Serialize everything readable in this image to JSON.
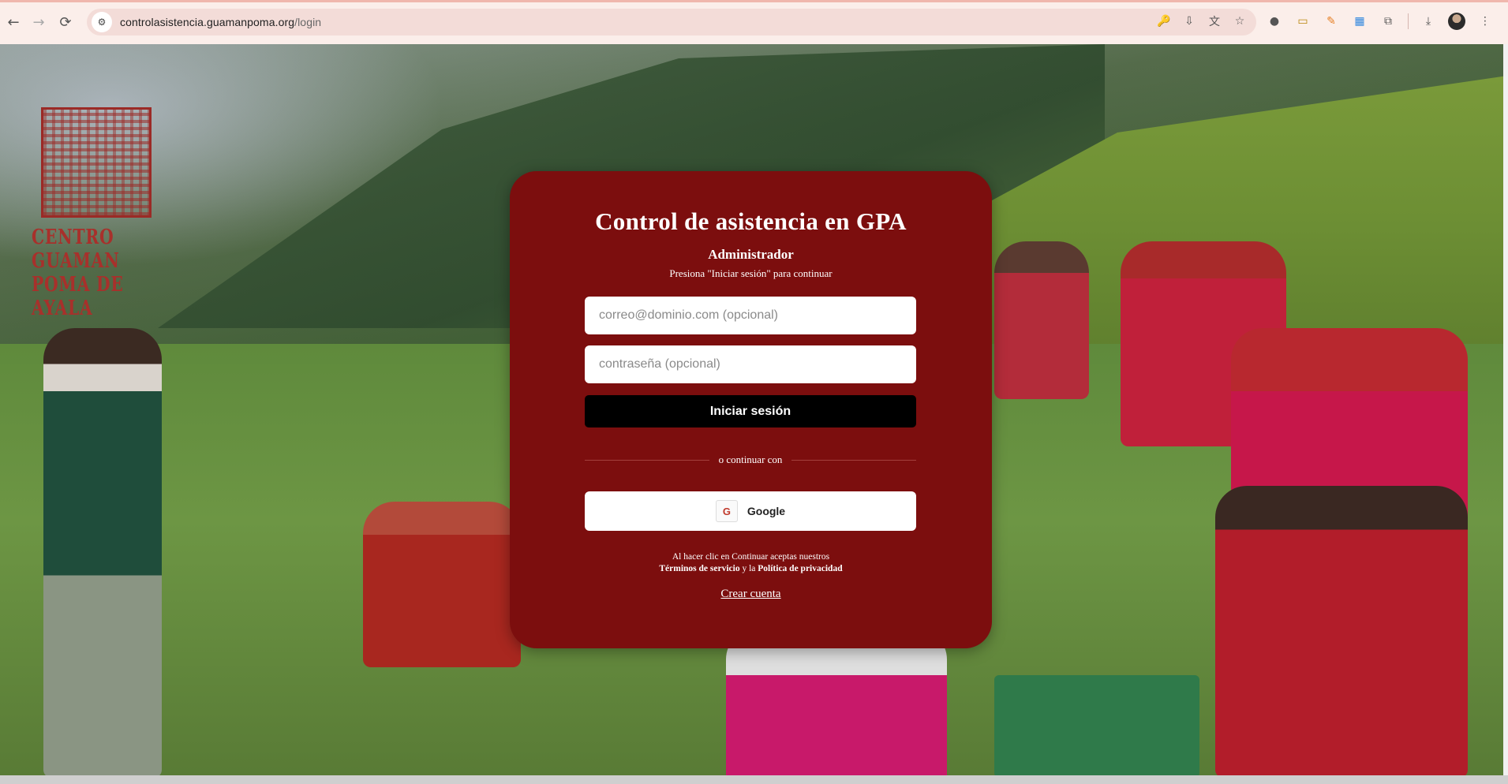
{
  "browser": {
    "url_host": "controlasistencia.guamanpoma.org",
    "url_path": "/login",
    "back_icon": "←",
    "forward_icon": "→",
    "reload_icon": "⟳",
    "site_info_icon": "⚙",
    "omnibox_icons": [
      "🔑",
      "⇩",
      "文",
      "☆"
    ],
    "extension_icons": [
      "●",
      "▭",
      "✎",
      "▦",
      "⧉",
      "⤓"
    ],
    "menu_icon": "⋮"
  },
  "logo": {
    "text_line1": "Centro Guaman",
    "text_line2": "Poma de Ayala"
  },
  "login": {
    "title": "Control de asistencia en GPA",
    "role": "Administrador",
    "hint": "Presiona \"Iniciar sesión\" para continuar",
    "email_placeholder": "correo@dominio.com (opcional)",
    "password_placeholder": "contraseña (opcional)",
    "submit_label": "Iniciar sesión",
    "divider_text": "o continuar con",
    "google_label": "Google",
    "google_icon": "G",
    "legal_line1": "Al hacer clic en Continuar aceptas nuestros",
    "terms_label": "Términos de servicio",
    "legal_and": " y la ",
    "privacy_label": "Política de privacidad",
    "create_account": "Crear cuenta"
  },
  "colors": {
    "card_bg": "#7c0e0e",
    "primary_button": "#000000",
    "chrome_bg": "#fbeeea"
  }
}
